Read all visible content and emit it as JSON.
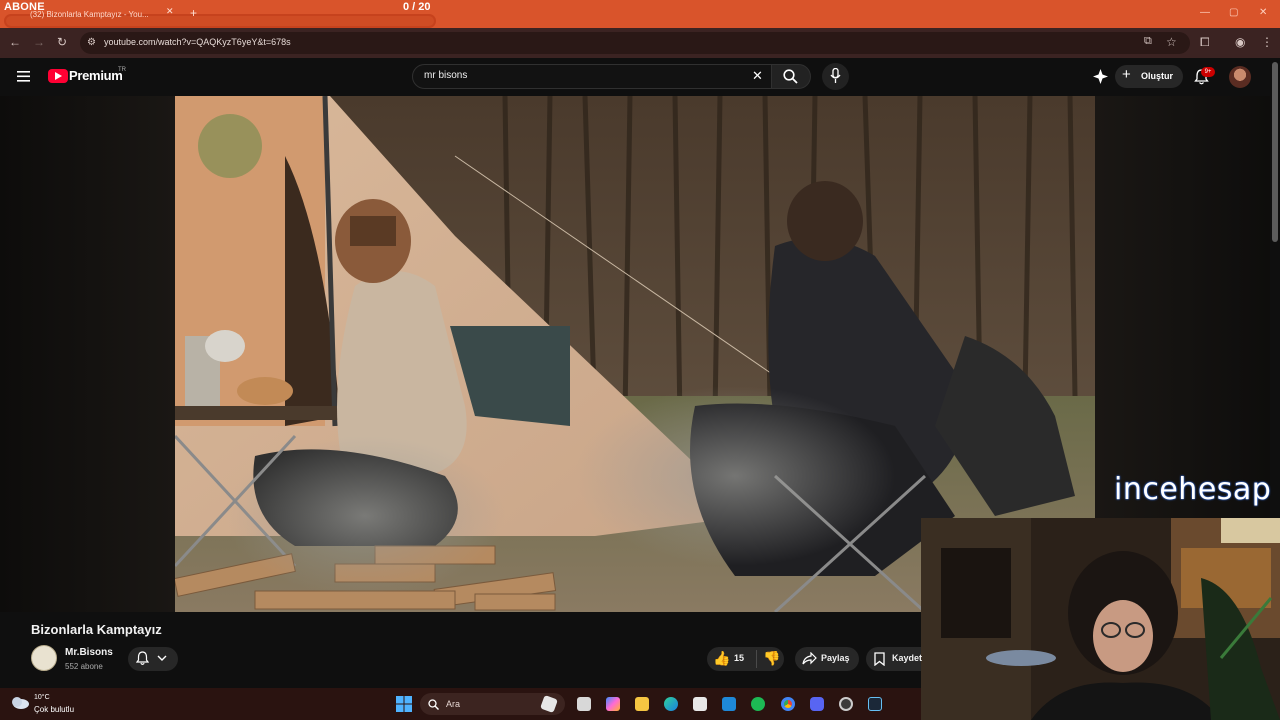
{
  "overlay": {
    "goal_label": "ABONE",
    "counter": "0  / 20"
  },
  "browser": {
    "tab_title": "(32) Bizonlarla Kamptayız - You...",
    "tab_close": "✕",
    "new_tab": "+",
    "url": "youtube.com/watch?v=QAQKyzT6yeY&t=678s",
    "window_controls": {
      "minimize": "—",
      "maximize": "▢",
      "close": "✕"
    }
  },
  "youtube": {
    "logo_text": "Premium",
    "region": "TR",
    "search": {
      "value": "mr bisons",
      "clear": "✕"
    },
    "create_label": "Oluştur",
    "notifications_badge": "9+"
  },
  "video": {
    "title": "Bizonlarla Kamptayız",
    "channel": {
      "name": "Mr.Bisons",
      "subscribers": "552 abone"
    },
    "likes": "15",
    "share_label": "Paylaş",
    "save_label": "Kaydet"
  },
  "streamer": {
    "watermark": "incehesap"
  },
  "taskbar": {
    "weather": {
      "temp": "10°C",
      "condition": "Çok bulutlu"
    },
    "search_label": "Ara"
  },
  "colors": {
    "browser_frame": "#d9542b",
    "youtube_red": "#ff0033",
    "youtube_bg": "#0f0f0f",
    "taskbar": "#2a1310"
  }
}
